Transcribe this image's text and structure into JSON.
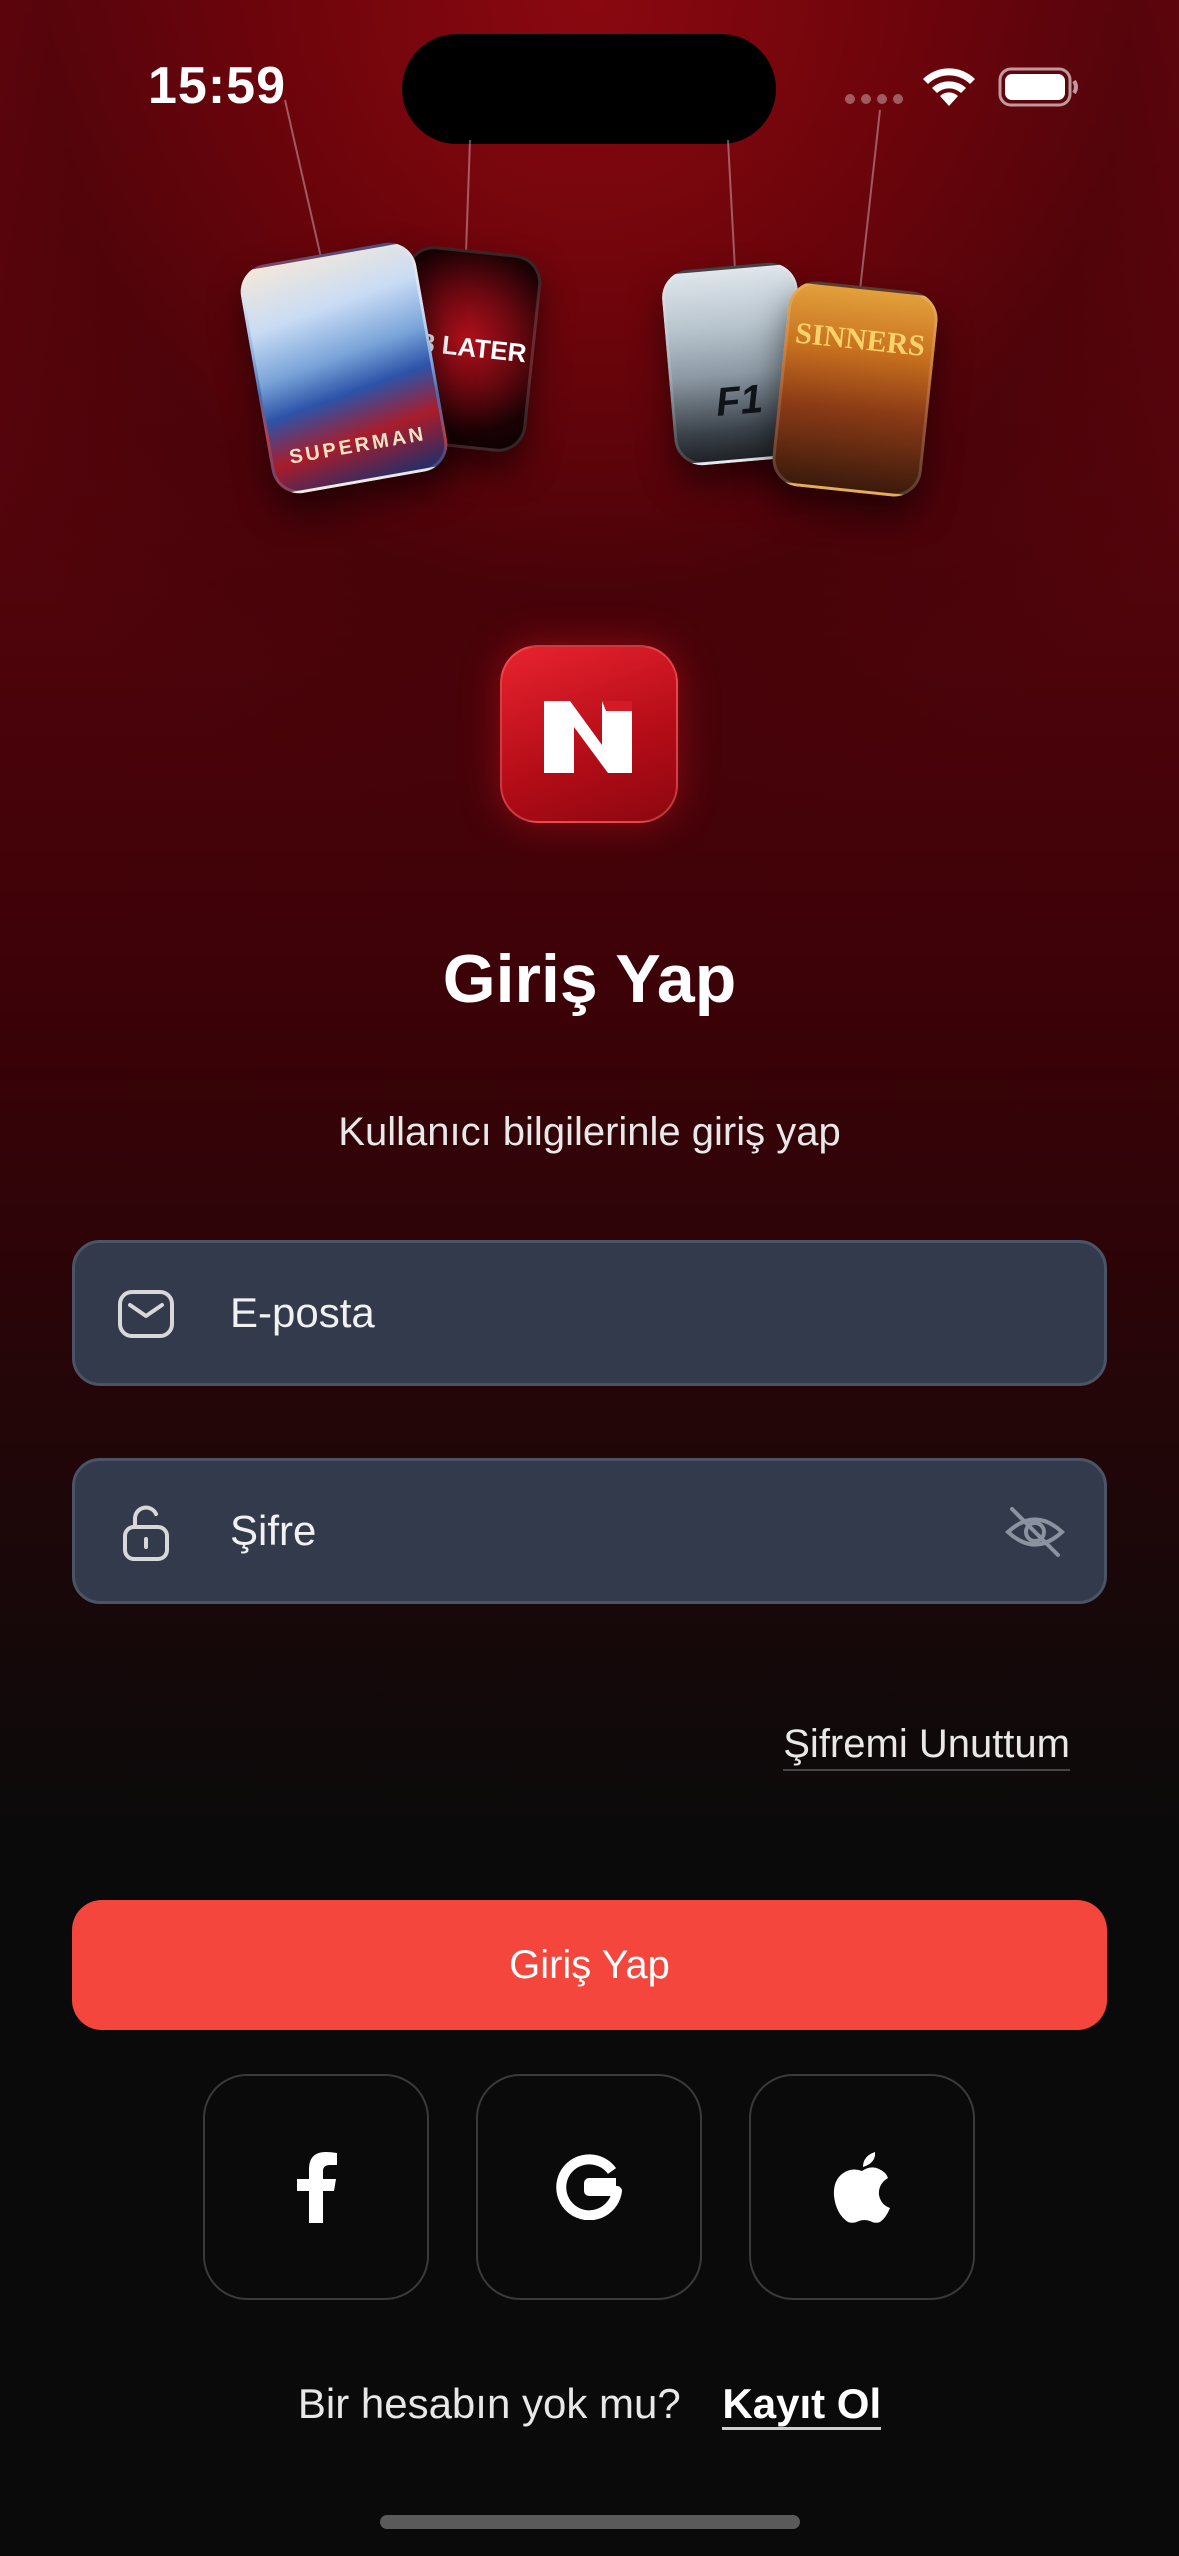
{
  "status_bar": {
    "time": "15:59"
  },
  "posters": {
    "superman": "SUPERMAN",
    "days28": "28 LATER",
    "f1": "F1",
    "sinners": "SINNERS"
  },
  "login": {
    "title": "Giriş Yap",
    "subtitle": "Kullanıcı bilgilerinle giriş yap",
    "email_placeholder": "E-posta",
    "password_placeholder": "Şifre",
    "forgot_password": "Şifremi Unuttum",
    "submit_label": "Giriş Yap"
  },
  "social": {
    "icons": [
      "facebook-icon",
      "google-icon",
      "apple-icon"
    ]
  },
  "signup": {
    "prompt": "Bir hesabın yok mu?",
    "link": "Kayıt Ol"
  },
  "colors": {
    "accent": "#f4463c",
    "brand_red": "#c8101c",
    "field_bg": "#323a4b",
    "background": "#0a0a0a"
  }
}
